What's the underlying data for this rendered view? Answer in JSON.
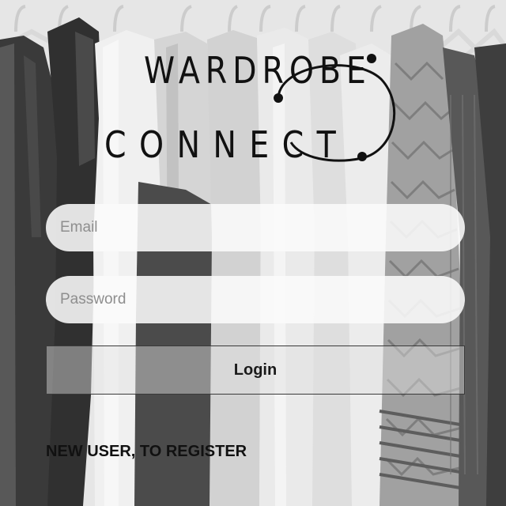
{
  "logo": {
    "line1": "WARDROBE",
    "line2": "CONNECT"
  },
  "form": {
    "email_placeholder": "Email",
    "password_placeholder": "Password",
    "login_label": "Login",
    "register_label": "NEW USER, TO REGISTER"
  },
  "colors": {
    "text": "#111111",
    "field_bg": "#fafafa",
    "button_border": "#3a3a3a"
  }
}
